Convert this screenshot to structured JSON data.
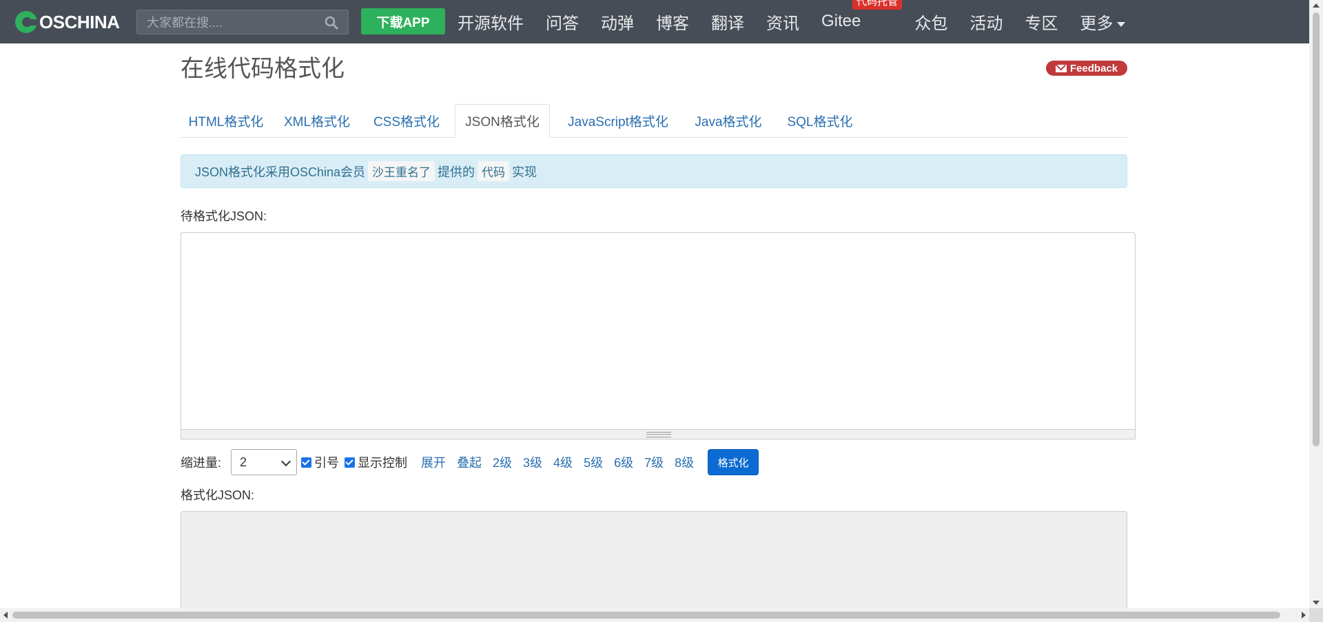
{
  "nav": {
    "logo_text": "OSCHINA",
    "search_placeholder": "大家都在搜....",
    "download_app": "下载APP",
    "links": [
      "开源软件",
      "问答",
      "动弹",
      "博客",
      "翻译",
      "资讯",
      "Gitee",
      "众包",
      "活动",
      "专区",
      "更多"
    ],
    "gitee_badge": "代码托管"
  },
  "page": {
    "title": "在线代码格式化",
    "feedback": "Feedback"
  },
  "tabs": [
    "HTML格式化",
    "XML格式化",
    "CSS格式化",
    "JSON格式化",
    "JavaScript格式化",
    "Java格式化",
    "SQL格式化"
  ],
  "active_tab": "JSON格式化",
  "alert": {
    "prefix": "JSON格式化采用OSChina会员",
    "member": "沙王重名了",
    "middle": "提供的",
    "code": "代码",
    "suffix": "实现"
  },
  "input": {
    "label": "待格式化JSON:",
    "value": ""
  },
  "controls": {
    "indent_label": "缩进量:",
    "indent_value": "2",
    "quote_label": "引号",
    "quote_checked": true,
    "show_control_label": "显示控制",
    "show_control_checked": true,
    "expand": "展开",
    "collapse": "叠起",
    "levels": [
      "2级",
      "3级",
      "4级",
      "5级",
      "6级",
      "7级",
      "8级"
    ],
    "format_button": "格式化"
  },
  "output": {
    "label": "格式化JSON:"
  },
  "colors": {
    "nav_bg": "#474d57",
    "green": "#2eb15c",
    "link": "#2a6fb0",
    "badge_red": "#d9302b",
    "primary": "#0b6bd3"
  }
}
